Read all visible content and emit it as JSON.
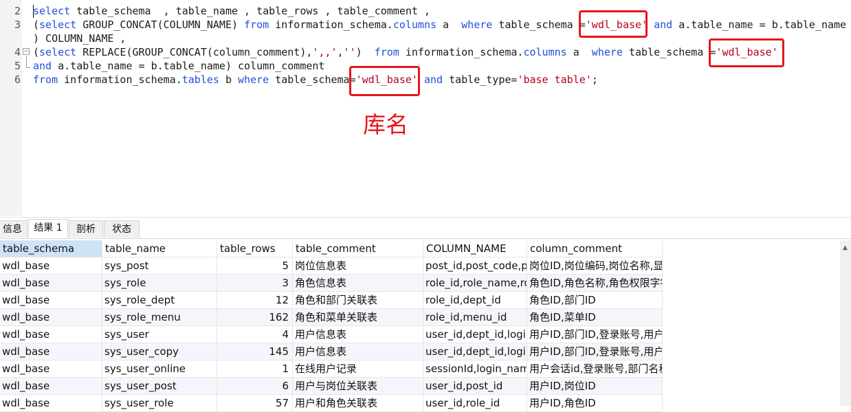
{
  "editor": {
    "line_numbers": [
      "2",
      "3",
      "4",
      "5",
      "6"
    ],
    "lines": [
      [
        {
          "t": "select",
          "c": "kw"
        },
        {
          "t": " table_schema  , table_name , table_rows , table_comment ,",
          "c": ""
        }
      ],
      [
        {
          "t": "(",
          "c": ""
        },
        {
          "t": "select",
          "c": "kw"
        },
        {
          "t": " GROUP_CONCAT(COLUMN_NAME) ",
          "c": ""
        },
        {
          "t": "from",
          "c": "kw"
        },
        {
          "t": " information_schema.",
          "c": ""
        },
        {
          "t": "columns",
          "c": "kw"
        },
        {
          "t": " a  ",
          "c": ""
        },
        {
          "t": "where",
          "c": "kw"
        },
        {
          "t": " table_schema =",
          "c": ""
        },
        {
          "t": "'wdl_base'",
          "c": "str"
        },
        {
          "t": " ",
          "c": ""
        },
        {
          "t": "and",
          "c": "kw"
        },
        {
          "t": " a.table_name = b.table_name",
          "c": ""
        }
      ],
      [
        {
          "t": ") COLUMN_NAME ,",
          "c": ""
        }
      ],
      [
        {
          "t": "(",
          "c": ""
        },
        {
          "t": "select",
          "c": "kw"
        },
        {
          "t": " REPLACE(GROUP_CONCAT(column_comment),",
          "c": ""
        },
        {
          "t": "',,'",
          "c": "str"
        },
        {
          "t": ",",
          "c": ""
        },
        {
          "t": "''",
          "c": "str"
        },
        {
          "t": ")  ",
          "c": ""
        },
        {
          "t": "from",
          "c": "kw"
        },
        {
          "t": " information_schema.",
          "c": ""
        },
        {
          "t": "columns",
          "c": "kw"
        },
        {
          "t": " a  ",
          "c": ""
        },
        {
          "t": "where",
          "c": "kw"
        },
        {
          "t": " table_schema =",
          "c": ""
        },
        {
          "t": "'wdl_base'",
          "c": "str"
        }
      ],
      [
        {
          "t": "and",
          "c": "kw"
        },
        {
          "t": " a.table_name = b.table_name) column_comment",
          "c": ""
        }
      ],
      [
        {
          "t": "from",
          "c": "kw"
        },
        {
          "t": " information_schema.",
          "c": ""
        },
        {
          "t": "tables",
          "c": "kw"
        },
        {
          "t": " b ",
          "c": ""
        },
        {
          "t": "where",
          "c": "kw"
        },
        {
          "t": " table_schema=",
          "c": ""
        },
        {
          "t": "'wdl_base'",
          "c": "str"
        },
        {
          "t": " ",
          "c": ""
        },
        {
          "t": "and",
          "c": "kw"
        },
        {
          "t": " table_type=",
          "c": ""
        },
        {
          "t": "'base table'",
          "c": "str"
        },
        {
          "t": ";",
          "c": ""
        }
      ]
    ],
    "annotation": "库名",
    "colors": {
      "keyword": "#1f4fd6",
      "string": "#b3001b",
      "highlight": "#e8141b"
    }
  },
  "tabs": [
    {
      "label": "信息",
      "active": false
    },
    {
      "label": "结果 1",
      "active": true
    },
    {
      "label": "剖析",
      "active": false
    },
    {
      "label": "状态",
      "active": false
    }
  ],
  "grid": {
    "columns": [
      "table_schema",
      "table_name",
      "table_rows",
      "table_comment",
      "COLUMN_NAME",
      "column_comment"
    ],
    "rows": [
      [
        "wdl_base",
        "sys_post",
        "5",
        "岗位信息表",
        "post_id,post_code,p",
        "岗位ID,岗位编码,岗位名称,显示"
      ],
      [
        "wdl_base",
        "sys_role",
        "3",
        "角色信息表",
        "role_id,role_name,ro",
        "角色ID,角色名称,角色权限字符"
      ],
      [
        "wdl_base",
        "sys_role_dept",
        "12",
        "角色和部门关联表",
        "role_id,dept_id",
        "角色ID,部门ID"
      ],
      [
        "wdl_base",
        "sys_role_menu",
        "162",
        "角色和菜单关联表",
        "role_id,menu_id",
        "角色ID,菜单ID"
      ],
      [
        "wdl_base",
        "sys_user",
        "4",
        "用户信息表",
        "user_id,dept_id,login",
        "用户ID,部门ID,登录账号,用户昵"
      ],
      [
        "wdl_base",
        "sys_user_copy",
        "145",
        "用户信息表",
        "user_id,dept_id,login",
        "用户ID,部门ID,登录账号,用户昵"
      ],
      [
        "wdl_base",
        "sys_user_online",
        "1",
        "在线用户记录",
        "sessionId,login_name",
        "用户会话id,登录账号,部门名称"
      ],
      [
        "wdl_base",
        "sys_user_post",
        "6",
        "用户与岗位关联表",
        "user_id,post_id",
        "用户ID,岗位ID"
      ],
      [
        "wdl_base",
        "sys_user_role",
        "57",
        "用户和角色关联表",
        "user_id,role_id",
        "用户ID,角色ID"
      ]
    ]
  }
}
